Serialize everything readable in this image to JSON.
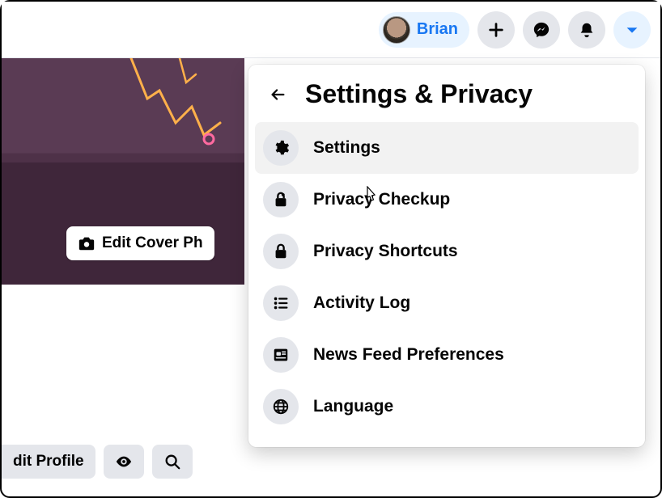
{
  "topbar": {
    "profile_name": "Brian"
  },
  "cover": {
    "edit_label": "Edit Cover Ph"
  },
  "bottom": {
    "edit_profile_label": "dit Profile"
  },
  "menu": {
    "title": "Settings & Privacy",
    "items": [
      {
        "id": "settings",
        "label": "Settings",
        "icon": "gear-icon",
        "hovered": true
      },
      {
        "id": "privacy-checkup",
        "label": "Privacy Checkup",
        "icon": "heart-lock-icon",
        "hovered": false
      },
      {
        "id": "privacy-shortcuts",
        "label": "Privacy Shortcuts",
        "icon": "lock-icon",
        "hovered": false
      },
      {
        "id": "activity-log",
        "label": "Activity Log",
        "icon": "list-icon",
        "hovered": false
      },
      {
        "id": "news-feed-preferences",
        "label": "News Feed Preferences",
        "icon": "news-icon",
        "hovered": false
      },
      {
        "id": "language",
        "label": "Language",
        "icon": "globe-icon",
        "hovered": false
      }
    ]
  }
}
